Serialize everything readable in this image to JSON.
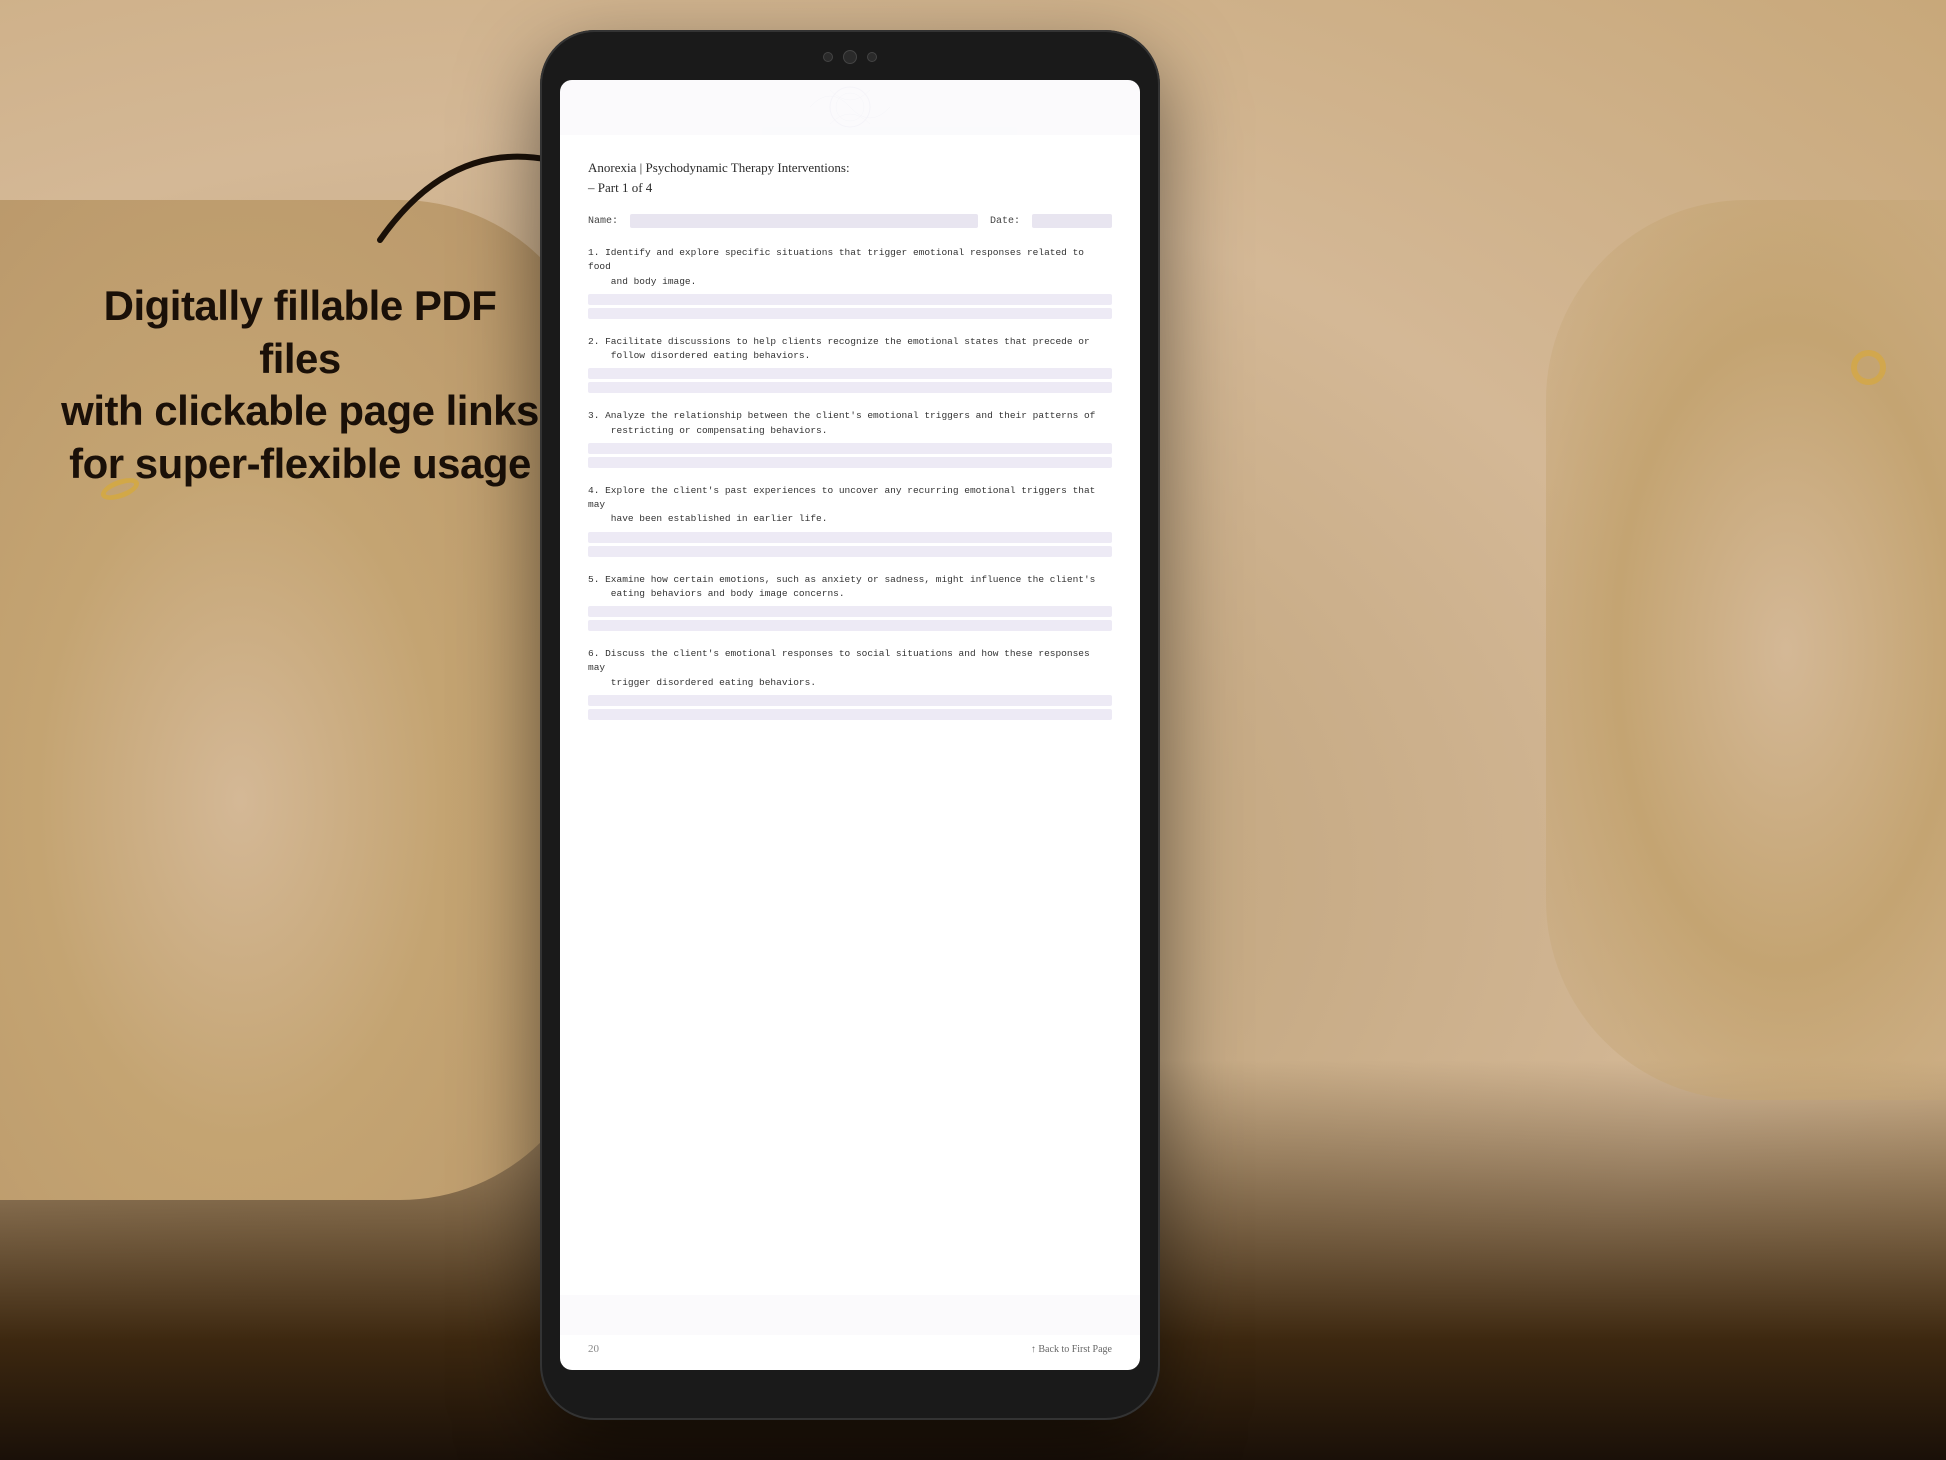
{
  "background": {
    "color": "#c4a882"
  },
  "arrow": {
    "description": "curved arrow pointing right toward tablet"
  },
  "left_text": {
    "line1": "Digitally fillable PDF files",
    "line2": "with clickable page links",
    "line3": "for super-flexible usage"
  },
  "tablet": {
    "document": {
      "title": "Anorexia | Psychodynamic Therapy Interventions:",
      "subtitle": "– Part 1 of 4",
      "name_label": "Name:",
      "date_label": "Date:",
      "items": [
        {
          "number": "1.",
          "text": "Identify and explore specific situations that trigger emotional responses related to food\nand body image."
        },
        {
          "number": "2.",
          "text": "Facilitate discussions to help clients recognize the emotional states that precede or\nfollow disordered eating behaviors."
        },
        {
          "number": "3.",
          "text": "Analyze the relationship between the client's emotional triggers and their patterns of\nrestricting or compensating behaviors."
        },
        {
          "number": "4.",
          "text": "Explore the client's past experiences to uncover any recurring emotional triggers that may\nhave been established in earlier life."
        },
        {
          "number": "5.",
          "text": "Examine how certain emotions, such as anxiety or sadness, might influence the client's\neating behaviors and body image concerns."
        },
        {
          "number": "6.",
          "text": "Discuss the client's emotional responses to social situations and how these responses may\ntrigger disordered eating behaviors."
        }
      ],
      "footer": {
        "page_number": "20",
        "back_link": "↑ Back to First Page"
      }
    }
  }
}
